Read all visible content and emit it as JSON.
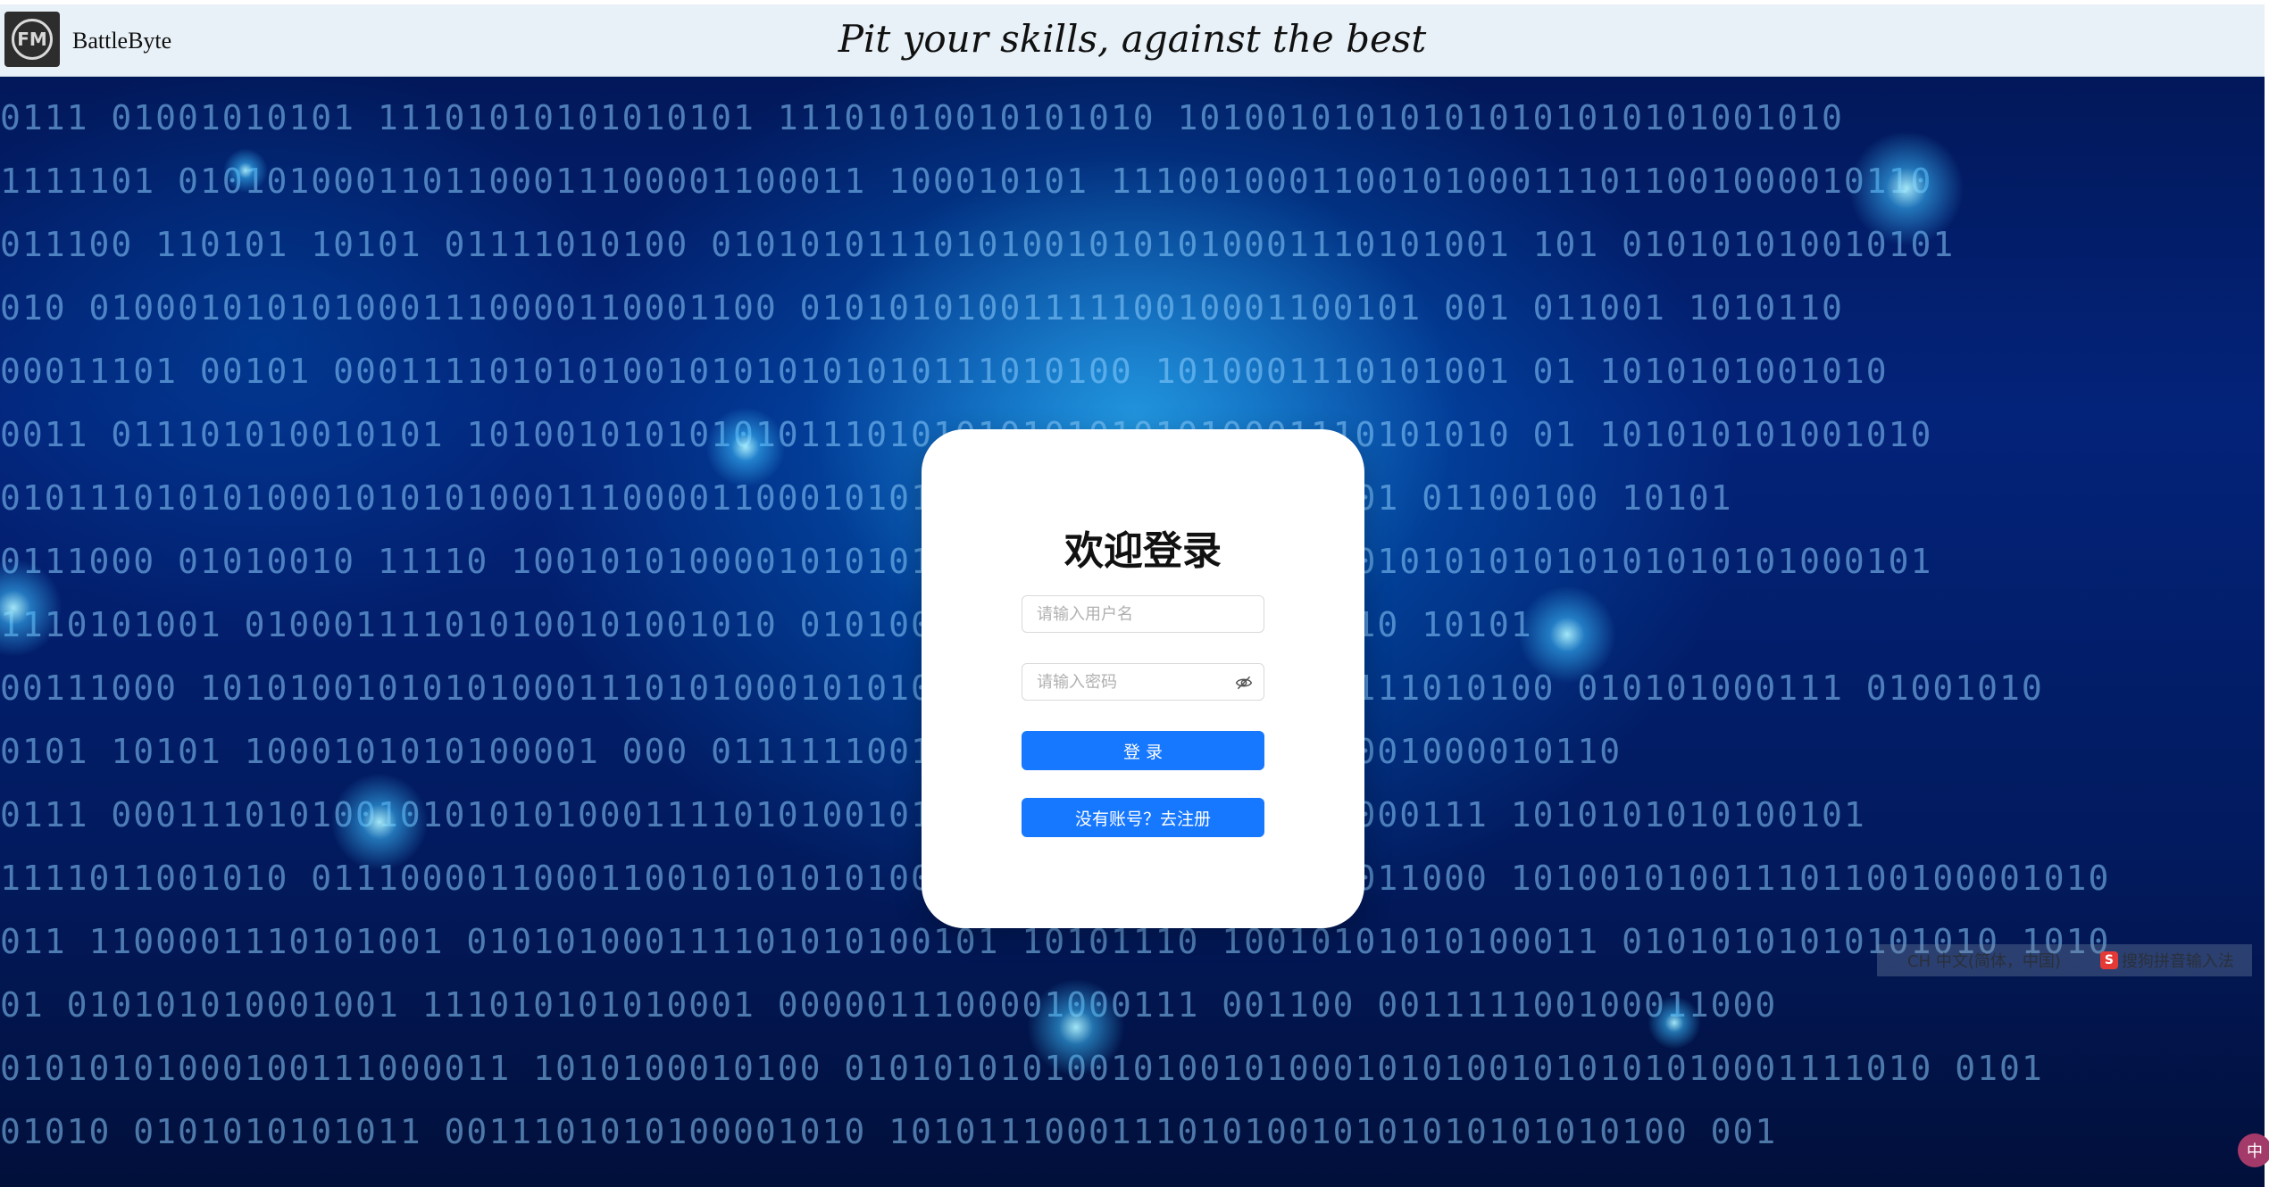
{
  "header": {
    "brand": "BattleByte",
    "tagline": "Pit your skills, against the best",
    "logo_text": "FM"
  },
  "background": {
    "lines": [
      "0111       01001010101       11101010101010101     11101010010101010       101001010101010101010101001010",
      "1111101    0101010001101100011100001100011       100010101       1110010001100101000111011001000010110",
      "011100     110101    10101    01111010100     010101011101010010101010001110101001   101   010101010010101",
      "010      0100010101010001110000110001100           0101010100111110010001100101   001   011001     1010110",
      "   00011101    00101    000111101010100101010101010111010100          1010001110101001   01    1010101001010",
      "0011     011101010010101       10100101010101011101010101010101010001110101010    01    101010101001010",
      "0101110101010001010101000111000011000101010          0111110010        0101   001   01100100       10101",
      "0111000    01010010         11110    1001010100001010101010101000111010100101010101010101010101000101",
      "    1110101001    010001111010100101001010             010100010    01010101010101010    10101",
      "00111000   1010100101010100011101010001010100101010101010101000111010100     010101000111    01001010",
      "0101  10101  1000101010100001    000          01111110010001100101000111011001000010110",
      "0111  00011101010010101010100011110101001010101010101011101010000111     1010101010100101",
      "1111011001010     01110000110001100101010101001011101010111100100011000      101001010011101100100001010",
      "011  1100001110101001  010101000111101010100101    10101110    10010101010100011      01010101010101010     1010",
      "01      010101010001001     111010101010001       0000011100001000111     001100       001111100100011000",
      "01010101000100111000011      1010100010100      0101010101001010010100010101001010101010001111010    0101",
      "01010     0101010101011    0011101010100001010             101011100011101010010101010101010100      001"
    ]
  },
  "login": {
    "title": "欢迎登录",
    "username_placeholder": "请输入用户名",
    "username_value": "",
    "password_placeholder": "请输入密码",
    "password_value": "",
    "password_toggle_icon": "eye-slash-icon",
    "login_button": "登 录",
    "register_button": "没有账号？去注册"
  },
  "ime": {
    "left_text": "CH 中文(简体，中国)",
    "right_text": "搜狗拼音输入法",
    "right_icon_text": "S"
  },
  "corner_badge": "中",
  "colors": {
    "primary": "#1677ff",
    "header_bg": "#e8f1f7",
    "bg_dark": "#02185a"
  }
}
